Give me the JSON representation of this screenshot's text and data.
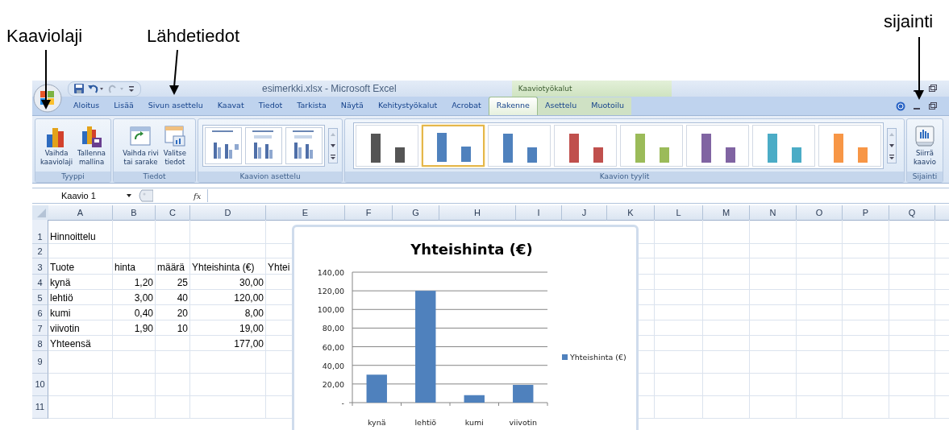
{
  "annotations": [
    {
      "label": "Kaaviolaji"
    },
    {
      "label": "Lähdetiedot"
    },
    {
      "label": "sijainti"
    }
  ],
  "window": {
    "title": "esimerkki.xlsx - Microsoft Excel",
    "contextual_title": "Kaaviotyökalut"
  },
  "tabs": [
    {
      "label": "Aloitus",
      "selected": false,
      "contextual": false
    },
    {
      "label": "Lisää",
      "selected": false,
      "contextual": false
    },
    {
      "label": "Sivun asettelu",
      "selected": false,
      "contextual": false
    },
    {
      "label": "Kaavat",
      "selected": false,
      "contextual": false
    },
    {
      "label": "Tiedot",
      "selected": false,
      "contextual": false
    },
    {
      "label": "Tarkista",
      "selected": false,
      "contextual": false
    },
    {
      "label": "Näytä",
      "selected": false,
      "contextual": false
    },
    {
      "label": "Kehitystyökalut",
      "selected": false,
      "contextual": false
    },
    {
      "label": "Acrobat",
      "selected": false,
      "contextual": false
    },
    {
      "label": "Rakenne",
      "selected": true,
      "contextual": true
    },
    {
      "label": "Asettelu",
      "selected": false,
      "contextual": true
    },
    {
      "label": "Muotoilu",
      "selected": false,
      "contextual": true
    }
  ],
  "ribbon": {
    "groups": [
      {
        "title": "Tyyppi",
        "kind": "buttons",
        "buttons": [
          {
            "lines": [
              "Vaihda",
              "kaaviolaji"
            ]
          },
          {
            "lines": [
              "Tallenna",
              "mallina"
            ]
          }
        ]
      },
      {
        "title": "Tiedot",
        "kind": "buttons",
        "buttons": [
          {
            "lines": [
              "Vaihda rivi",
              "tai sarake"
            ]
          },
          {
            "lines": [
              "Valitse",
              "tiedot"
            ]
          }
        ]
      },
      {
        "title": "Kaavion asettelu",
        "kind": "layouts",
        "items": [
          {
            "selected": false
          },
          {
            "selected": false
          },
          {
            "selected": false
          }
        ]
      },
      {
        "title": "Kaavion tyylit",
        "kind": "styles",
        "items": [
          {
            "color": "#555555",
            "selected": false
          },
          {
            "color": "#4f81bd",
            "selected": true
          },
          {
            "color": "#4f81bd",
            "selected": false
          },
          {
            "color": "#c0504d",
            "selected": false
          },
          {
            "color": "#9bbb59",
            "selected": false
          },
          {
            "color": "#8064a2",
            "selected": false
          },
          {
            "color": "#4bacc6",
            "selected": false
          },
          {
            "color": "#f79646",
            "selected": false
          }
        ]
      },
      {
        "title": "Sijainti",
        "kind": "buttons",
        "buttons": [
          {
            "lines": [
              "Siirrä",
              "kaavio"
            ]
          }
        ]
      }
    ]
  },
  "formula_bar": {
    "name_box": "Kaavio 1",
    "fx": "fx"
  },
  "sheet": {
    "columns": [
      "A",
      "B",
      "C",
      "D",
      "E",
      "F",
      "G",
      "H",
      "I",
      "J",
      "K",
      "L",
      "M",
      "N",
      "O",
      "P",
      "Q"
    ],
    "rows": [
      {
        "header": "1",
        "cells": [
          {
            "text": "Hinnoittelu",
            "kind": "text"
          }
        ]
      },
      {
        "header": "2",
        "cells": []
      },
      {
        "header": "3",
        "cells": [
          {
            "text": "Tuote",
            "kind": "text"
          },
          {
            "text": "hinta",
            "kind": "text"
          },
          {
            "text": "määrä",
            "kind": "text"
          },
          {
            "text": "Yhteishinta (€)",
            "kind": "text"
          },
          {
            "text": "Yhtei",
            "kind": "text"
          }
        ]
      },
      {
        "header": "4",
        "cells": [
          {
            "text": "kynä",
            "kind": "text"
          },
          {
            "text": "1,20",
            "kind": "number"
          },
          {
            "text": "25",
            "kind": "number"
          },
          {
            "text": "30,00",
            "kind": "number"
          }
        ]
      },
      {
        "header": "5",
        "cells": [
          {
            "text": "lehtiö",
            "kind": "text"
          },
          {
            "text": "3,00",
            "kind": "number"
          },
          {
            "text": "40",
            "kind": "number"
          },
          {
            "text": "120,00",
            "kind": "number"
          }
        ]
      },
      {
        "header": "6",
        "cells": [
          {
            "text": "kumi",
            "kind": "text"
          },
          {
            "text": "0,40",
            "kind": "number"
          },
          {
            "text": "20",
            "kind": "number"
          },
          {
            "text": "8,00",
            "kind": "number"
          }
        ]
      },
      {
        "header": "7",
        "cells": [
          {
            "text": "viivotin",
            "kind": "text"
          },
          {
            "text": "1,90",
            "kind": "number"
          },
          {
            "text": "10",
            "kind": "number"
          },
          {
            "text": "19,00",
            "kind": "number"
          }
        ]
      },
      {
        "header": "8",
        "cells": [
          {
            "text": "Yhteensä",
            "kind": "text"
          },
          null,
          null,
          {
            "text": "177,00",
            "kind": "number"
          }
        ]
      },
      {
        "header": "9",
        "cells": []
      },
      {
        "header": "10",
        "cells": []
      },
      {
        "header": "11",
        "cells": []
      }
    ],
    "chart": {
      "chart_data": {
        "type": "bar",
        "title": "Yhteishinta (€)",
        "categories": [
          "kynä",
          "lehtiö",
          "kumi",
          "viivotin"
        ],
        "series": [
          {
            "name": "Yhteishinta (€)",
            "color": "#4f81bd",
            "values": [
              30,
              120,
              8,
              19
            ]
          }
        ],
        "ylim": [
          0,
          140
        ],
        "grid": true,
        "yticks": [
          {
            "value": 0,
            "label": "-"
          },
          {
            "value": 20,
            "label": "20,00"
          },
          {
            "value": 40,
            "label": "40,00"
          },
          {
            "value": 60,
            "label": "60,00"
          },
          {
            "value": 80,
            "label": "80,00"
          },
          {
            "value": 100,
            "label": "100,00"
          },
          {
            "value": 120,
            "label": "120,00"
          },
          {
            "value": 140,
            "label": "140,00"
          }
        ]
      }
    }
  }
}
